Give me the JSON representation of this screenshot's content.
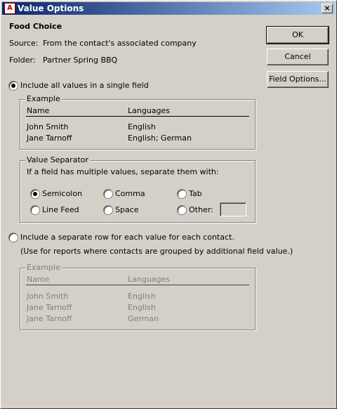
{
  "window": {
    "title": "Value Options",
    "close": "×"
  },
  "field": {
    "name": "Food Choice",
    "source_label": "Source:",
    "source_value": "From the contact's associated company",
    "folder_label": "Folder:",
    "folder_value": "Partner Spring BBQ"
  },
  "buttons": {
    "ok": "OK",
    "cancel": "Cancel",
    "field_options": "Field Options..."
  },
  "option_single": {
    "label": "Include all values in a single field",
    "selected": true,
    "example": {
      "title": "Example",
      "headers": [
        "Name",
        "Languages"
      ],
      "rows": [
        [
          "John Smith",
          "English"
        ],
        [
          "Jane Tarnoff",
          "English; German"
        ]
      ]
    }
  },
  "separator": {
    "title": "Value Separator",
    "instruction": "If a field has multiple values, separate them with:",
    "options": [
      "Semicolon",
      "Comma",
      "Tab",
      "Line Feed",
      "Space",
      "Other:"
    ],
    "selected": "Semicolon",
    "other_value": ""
  },
  "option_separate": {
    "label": "Include a separate row for each value for each contact.",
    "note": "(Use for reports where contacts are grouped by additional field value.)",
    "selected": false,
    "example": {
      "title": "Example",
      "headers": [
        "Name",
        "Languages"
      ],
      "rows": [
        [
          "John Smith",
          "English"
        ],
        [
          "Jane Tarnoff",
          "English"
        ],
        [
          "Jane Tarnoff",
          "German"
        ]
      ]
    }
  }
}
